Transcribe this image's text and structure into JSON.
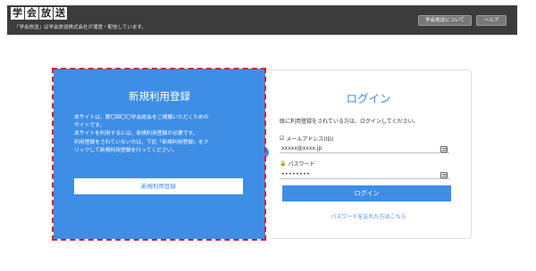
{
  "header": {
    "logo_chars": [
      "学",
      "会",
      "放",
      "送"
    ],
    "tagline": "「学会放送」は学会放送株式会社が運営・配信しています。",
    "buttons": {
      "about": "学会放送について",
      "help": "ヘルプ"
    }
  },
  "register": {
    "title": "新規利用登録",
    "description": [
      "本サイトは、第〇回〇〇学会総会をご視聴いただくための",
      "サイトです。",
      "本サイトを利用するには、新規利用登録が必要です。",
      "利用登録をされていない方は、下記「新規利用登録」をク",
      "リックして新規利用登録を行ってください。"
    ],
    "button_label": "新規利用登録"
  },
  "login": {
    "title": "ログイン",
    "note": "既に利用登録をされている方は、ログインしてください。",
    "email_label": "メールアドレス(ID)",
    "email_value": "xxxxx@xxxx.jp",
    "password_label": "パスワード",
    "password_value": "••••••••",
    "button_label": "ログイン",
    "forgot_link": "パスワードを忘れた方はこちら"
  },
  "colors": {
    "accent": "#3e8ee6",
    "header_bg": "#3c3c3c",
    "highlight": "#d41f1f"
  },
  "icons": [
    "email-checkbox-icon",
    "lock-icon",
    "keyboard-icon"
  ]
}
